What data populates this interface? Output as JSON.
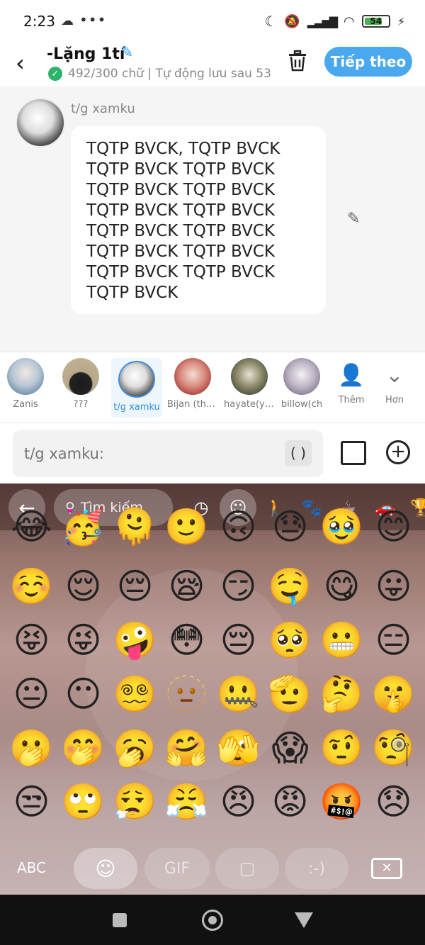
{
  "status_bar": {
    "time": "2:23",
    "battery": "54",
    "cloud_icon": "cloud-icon",
    "more": "•••"
  },
  "header": {
    "title": "-Lặng 1tí",
    "save_status": "492/300 chữ | Tự động lưu sau 53",
    "next_label": "Tiếp theo",
    "accent_color": "#4aa8ef"
  },
  "message": {
    "author": "t/g xamku",
    "lines": [
      "TQTP BVCK, TQTP BVCK",
      "TQTP BVCK TQTP BVCK",
      "TQTP BVCK TQTP BVCK",
      "TQTP BVCK TQTP BVCK",
      "TQTP BVCK TQTP BVCK",
      "TQTP BVCK TQTP BVCK",
      "TQTP BVCK TQTP BVCK",
      "TQTP BVCK"
    ]
  },
  "characters": [
    {
      "name": "Zanis",
      "selected": false
    },
    {
      "name": "???",
      "selected": false
    },
    {
      "name": "t/g xamku",
      "selected": true
    },
    {
      "name": "Bijan (thầ…",
      "selected": false
    },
    {
      "name": "hayate(ya…",
      "selected": false
    },
    {
      "name": "billow(ch",
      "selected": false
    }
  ],
  "char_actions": {
    "add_label": "Thêm",
    "more_label": "Hơn"
  },
  "input": {
    "placeholder": "t/g xamku:",
    "paren": "( )"
  },
  "keyboard": {
    "search_placeholder": "Tìm kiếm",
    "categories": [
      "recent-icon",
      "smiley-icon",
      "person-icon",
      "animal-icon",
      "food-icon",
      "travel-icon",
      "trophy-icon"
    ],
    "emoji_rows": [
      [
        "😂",
        "🥳",
        "🫠",
        "🙂",
        "🙃",
        "😓",
        "🥹",
        "😊"
      ],
      [
        "☺️",
        "😌",
        "😔",
        "😪",
        "😏",
        "🤤",
        "😋",
        "😛"
      ],
      [
        "😝",
        "😜",
        "🤪",
        "😳",
        "😔",
        "🥺",
        "😬",
        "😑"
      ],
      [
        "😐",
        "😶",
        "😵‍💫",
        "🫥",
        "🤐",
        "🫡",
        "🤔",
        "🤫"
      ],
      [
        "🫢",
        "🤭",
        "🥱",
        "🤗",
        "🫣",
        "😱",
        "🤨",
        "🧐"
      ],
      [
        "😒",
        "🙄",
        "😮‍💨",
        "😤",
        "😠",
        "😡",
        "🤬",
        "😞"
      ]
    ],
    "abc_label": "ABC",
    "gif_label": "GIF",
    "emoticon_label": ":-)"
  }
}
